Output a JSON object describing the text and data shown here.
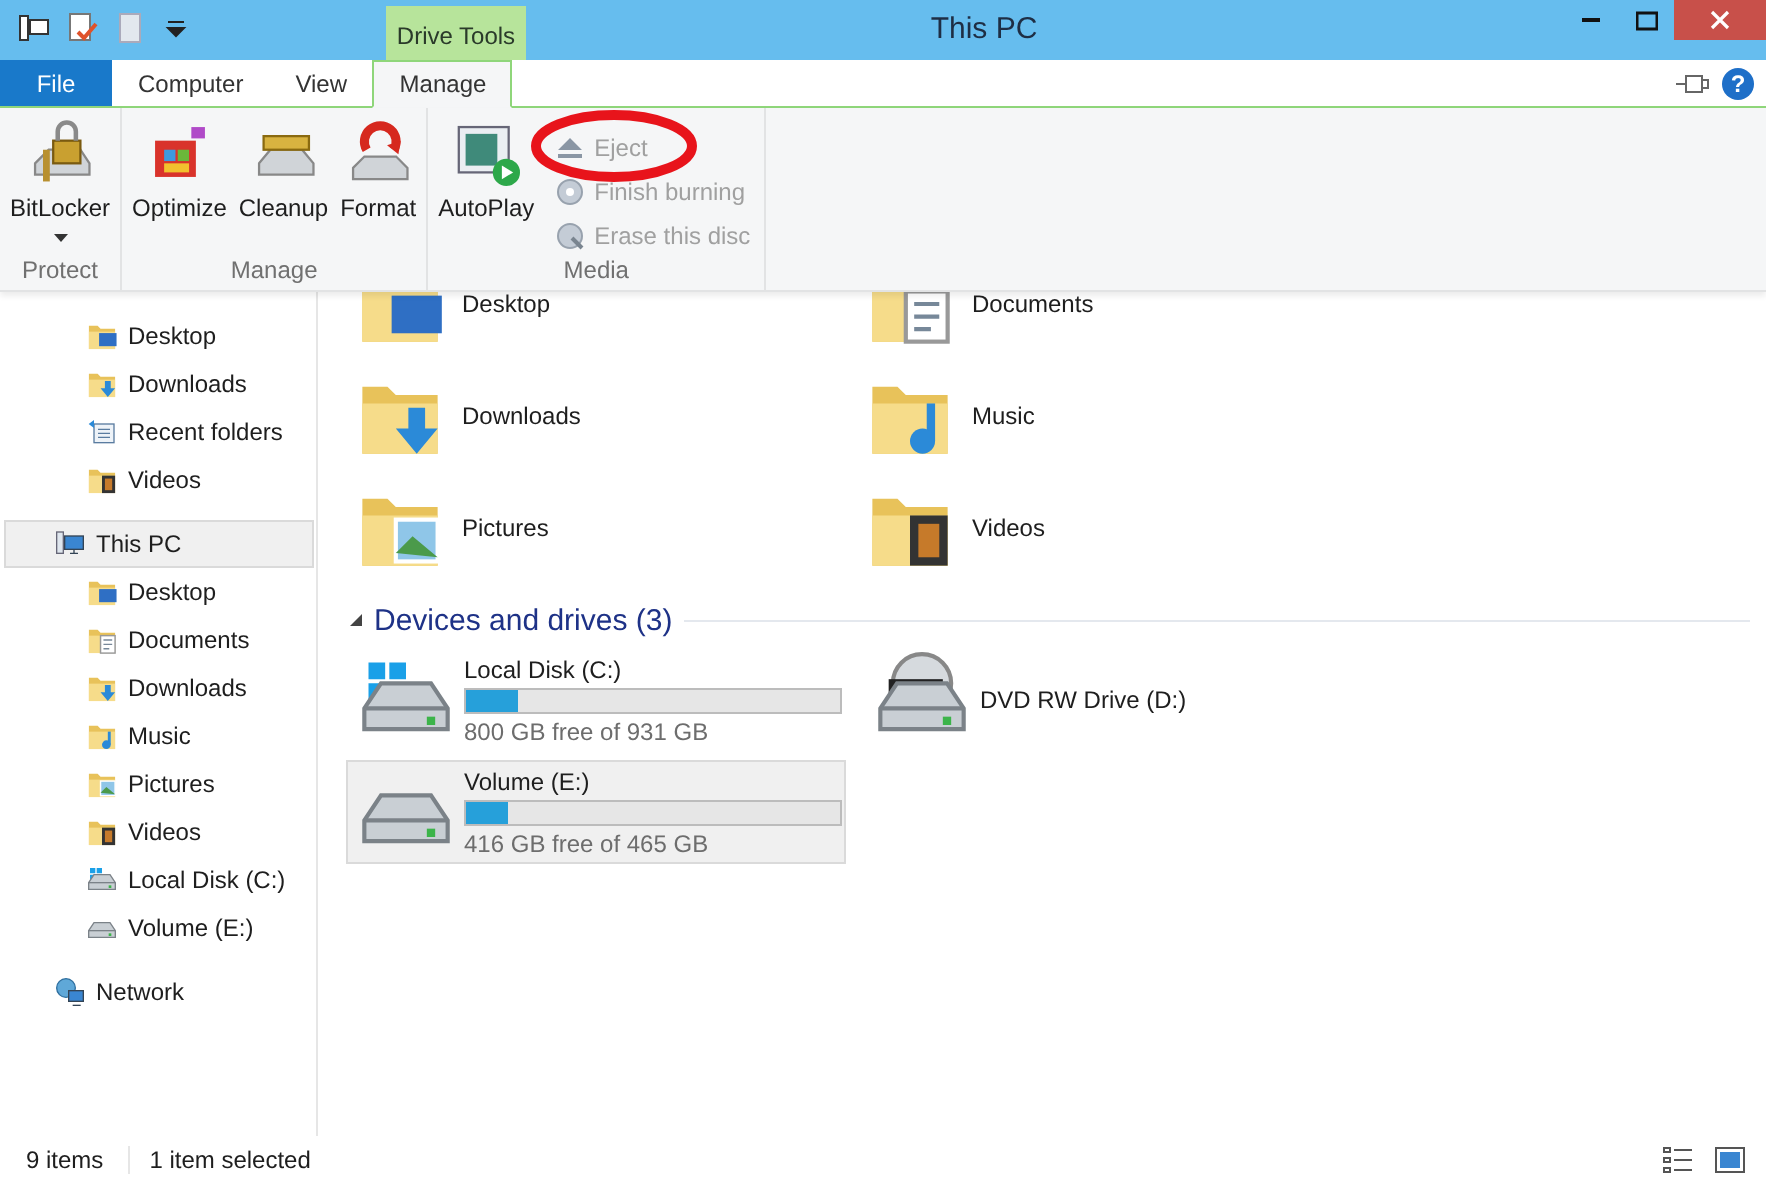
{
  "window": {
    "title": "This PC",
    "context_tab_header": "Drive Tools"
  },
  "quick_access": [
    {
      "kind": "pc"
    },
    {
      "kind": "properties"
    },
    {
      "kind": "newfolder"
    },
    {
      "kind": "dropdown"
    }
  ],
  "help_button": "?",
  "tabs": [
    {
      "label": "File",
      "kind": "file",
      "selected": false
    },
    {
      "label": "Computer",
      "kind": "plain",
      "selected": false
    },
    {
      "label": "View",
      "kind": "plain",
      "selected": false
    },
    {
      "label": "Manage",
      "kind": "context",
      "selected": true
    }
  ],
  "ribbon": {
    "groups": [
      {
        "label": "Protect",
        "buttons": [
          {
            "label": "BitLocker",
            "kind": "bitlocker",
            "dropdown": true
          }
        ]
      },
      {
        "label": "Manage",
        "buttons": [
          {
            "label": "Optimize",
            "kind": "optimize",
            "dropdown": false
          },
          {
            "label": "Cleanup",
            "kind": "cleanup",
            "dropdown": false
          },
          {
            "label": "Format",
            "kind": "format",
            "dropdown": false
          }
        ]
      },
      {
        "label": "Media",
        "buttons": [
          {
            "label": "AutoPlay",
            "kind": "autoplay",
            "dropdown": false
          }
        ],
        "small_buttons": [
          {
            "label": "Eject",
            "kind": "eject",
            "disabled": true
          },
          {
            "label": "Finish burning",
            "kind": "burn",
            "disabled": true
          },
          {
            "label": "Erase this disc",
            "kind": "erase",
            "disabled": true
          }
        ]
      }
    ]
  },
  "annotations": [
    {
      "kind": "ellipse",
      "color": "#e8141b"
    }
  ],
  "favorites_items": [
    {
      "label": "Desktop",
      "kind": "desktop"
    },
    {
      "label": "Downloads",
      "kind": "downloads"
    },
    {
      "label": "Recent folders",
      "kind": "recent"
    },
    {
      "label": "Videos",
      "kind": "videos"
    }
  ],
  "nav_tree": [
    {
      "label": "This PC",
      "kind": "pc",
      "selected": true,
      "children": [
        {
          "label": "Desktop",
          "kind": "desktop",
          "selected": false
        },
        {
          "label": "Documents",
          "kind": "documents",
          "selected": false
        },
        {
          "label": "Downloads",
          "kind": "downloads",
          "selected": false
        },
        {
          "label": "Music",
          "kind": "music",
          "selected": false
        },
        {
          "label": "Pictures",
          "kind": "pictures",
          "selected": false
        },
        {
          "label": "Videos",
          "kind": "videos",
          "selected": false
        },
        {
          "label": "Local Disk (C:)",
          "kind": "diskc",
          "selected": false
        },
        {
          "label": "Volume (E:)",
          "kind": "volume",
          "selected": false
        }
      ]
    },
    {
      "label": "Network",
      "kind": "network",
      "selected": false
    }
  ],
  "folders": [
    {
      "label": "Desktop",
      "kind": "desktop"
    },
    {
      "label": "Documents",
      "kind": "documents"
    },
    {
      "label": "Downloads",
      "kind": "downloads"
    },
    {
      "label": "Music",
      "kind": "music"
    },
    {
      "label": "Pictures",
      "kind": "pictures"
    },
    {
      "label": "Videos",
      "kind": "videos"
    }
  ],
  "devices": {
    "heading": "Devices and drives (3)",
    "expanded": true,
    "items": [
      {
        "name": "Local Disk (C:)",
        "kind": "diskc",
        "level": 0.14,
        "free": "800 GB free of 931 GB",
        "selected": false
      },
      {
        "name": "DVD RW Drive (D:)",
        "kind": "dvd",
        "selected": false
      },
      {
        "name": "Volume (E:)",
        "kind": "volume",
        "level": 0.11,
        "free": "416 GB free of 465 GB",
        "selected": true
      }
    ]
  },
  "status_bar": {
    "item_count": "9 items",
    "selection": "1 item selected"
  }
}
